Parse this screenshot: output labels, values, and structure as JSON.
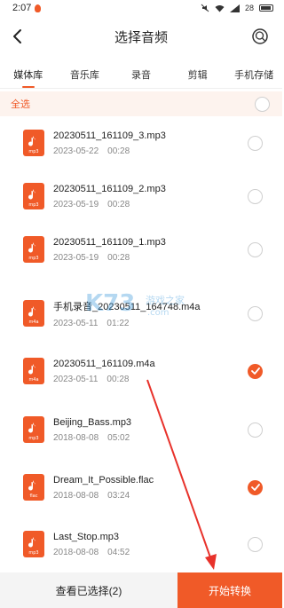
{
  "status_bar": {
    "time": "2:07",
    "battery": "28"
  },
  "header": {
    "title": "选择音频",
    "back_icon": "chevron-left-icon",
    "search_icon": "search-icon"
  },
  "tabs": [
    {
      "label": "媒体库",
      "active": true
    },
    {
      "label": "音乐库",
      "active": false
    },
    {
      "label": "录音",
      "active": false
    },
    {
      "label": "剪辑",
      "active": false
    },
    {
      "label": "手机存储",
      "active": false
    }
  ],
  "select_all": {
    "label": "全选",
    "checked": false
  },
  "files": [
    {
      "name": "20230511_161109_3.mp3",
      "date": "2023-05-22",
      "duration": "00:28",
      "type": "mp3",
      "checked": false
    },
    {
      "name": "20230511_161109_2.mp3",
      "date": "2023-05-19",
      "duration": "00:28",
      "type": "mp3",
      "checked": false
    },
    {
      "name": "20230511_161109_1.mp3",
      "date": "2023-05-19",
      "duration": "00:28",
      "type": "mp3",
      "checked": false
    },
    {
      "name": "手机录音_20230511_164748.m4a",
      "date": "2023-05-11",
      "duration": "01:22",
      "type": "m4a",
      "checked": false
    },
    {
      "name": "20230511_161109.m4a",
      "date": "2023-05-11",
      "duration": "00:28",
      "type": "m4a",
      "checked": true
    },
    {
      "name": "Beijing_Bass.mp3",
      "date": "2018-08-08",
      "duration": "05:02",
      "type": "mp3",
      "checked": false
    },
    {
      "name": "Dream_It_Possible.flac",
      "date": "2018-08-08",
      "duration": "03:24",
      "type": "flac",
      "checked": true
    },
    {
      "name": "Last_Stop.mp3",
      "date": "2018-08-08",
      "duration": "04:52",
      "type": "mp3",
      "checked": false
    }
  ],
  "bottom": {
    "view_selected_label": "查看已选择(2)",
    "start_label": "开始转换"
  },
  "watermark": {
    "text": "K73",
    "sub": "游戏之家",
    "url": ".com"
  },
  "colors": {
    "accent": "#f05a28",
    "select_all_bg": "#fdf3ee",
    "annotation_arrow": "#e8322b"
  }
}
